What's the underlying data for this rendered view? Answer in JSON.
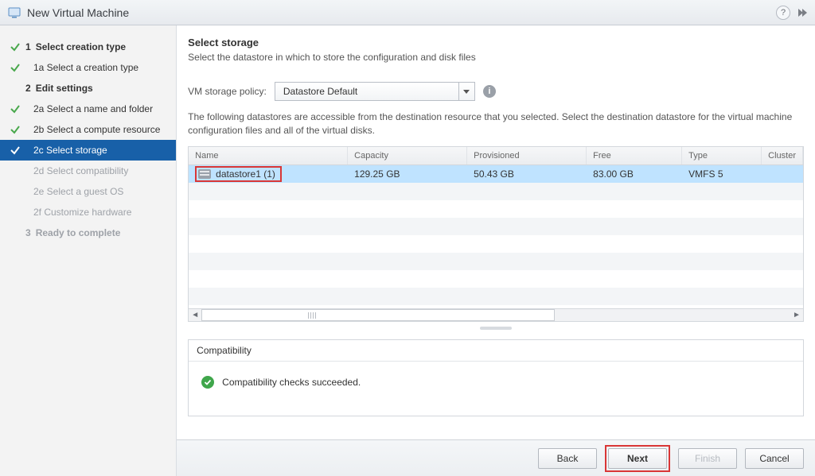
{
  "window": {
    "title": "New Virtual Machine"
  },
  "sidebar": {
    "s1": {
      "num": "1",
      "label": "Select creation type"
    },
    "s1a": "1a  Select a creation type",
    "s2": {
      "num": "2",
      "label": "Edit settings"
    },
    "s2a": "2a  Select a name and folder",
    "s2b": "2b  Select a compute resource",
    "s2c": "2c  Select storage",
    "s2d": "2d  Select compatibility",
    "s2e": "2e  Select a guest OS",
    "s2f": "2f  Customize hardware",
    "s3": {
      "num": "3",
      "label": "Ready to complete"
    }
  },
  "main": {
    "heading": "Select storage",
    "subtitle": "Select the datastore in which to store the configuration and disk files",
    "policy_label": "VM storage policy:",
    "policy_value": "Datastore Default",
    "description": "The following datastores are accessible from the destination resource that you selected. Select the destination datastore for the virtual machine configuration files and all of the virtual disks."
  },
  "table": {
    "headers": {
      "name": "Name",
      "capacity": "Capacity",
      "provisioned": "Provisioned",
      "free": "Free",
      "type": "Type",
      "cluster": "Cluster"
    },
    "row": {
      "name": "datastore1 (1)",
      "capacity": "129.25 GB",
      "provisioned": "50.43 GB",
      "free": "83.00 GB",
      "type": "VMFS 5",
      "cluster": ""
    }
  },
  "compat": {
    "heading": "Compatibility",
    "message": "Compatibility checks succeeded."
  },
  "footer": {
    "back": "Back",
    "next": "Next",
    "finish": "Finish",
    "cancel": "Cancel"
  }
}
